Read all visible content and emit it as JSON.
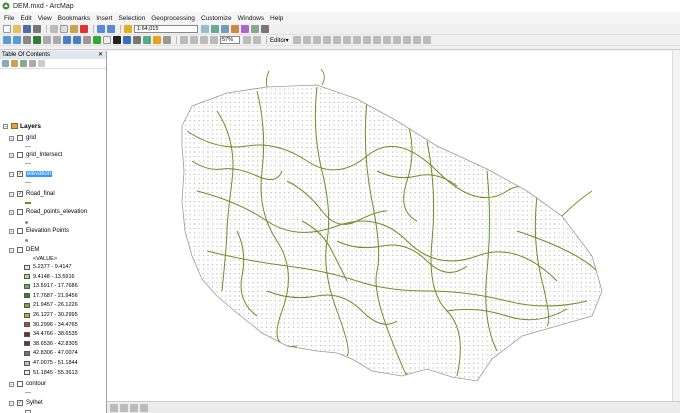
{
  "window": {
    "title": "DEM.mxd - ArcMap"
  },
  "menu": [
    "File",
    "Edit",
    "View",
    "Bookmarks",
    "Insert",
    "Selection",
    "Geoprocessing",
    "Customize",
    "Windows",
    "Help"
  ],
  "toolbar": {
    "scale": "1:64,015",
    "zoom": "57%",
    "editor_label": "Editor▾"
  },
  "toc": {
    "title": "Table Of Contents",
    "close_glyph": "✕",
    "root_label": "Layers",
    "layers": [
      {
        "name": "grid",
        "checked": false
      },
      {
        "name": "grid_Intersect",
        "checked": false
      },
      {
        "name": "elevation",
        "checked": true,
        "selected": true
      },
      {
        "name": "Road_final",
        "checked": true
      },
      {
        "name": "Road_points_elevation",
        "checked": false
      },
      {
        "name": "Elevation Points",
        "checked": false
      },
      {
        "name": "DEM",
        "checked": false
      },
      {
        "name": "contour",
        "checked": false
      },
      {
        "name": "Sylhet",
        "checked": true
      }
    ],
    "dem_field": "<VALUE>",
    "dem_classes": [
      {
        "label": "5.2377 - 9.4147",
        "color": "#d9f2d0"
      },
      {
        "label": "9.4148 - 13.5916",
        "color": "#a8dc8f"
      },
      {
        "label": "13.5917 - 17.7686",
        "color": "#5fb84a"
      },
      {
        "label": "17.7687 - 21.9456",
        "color": "#2d8a2a"
      },
      {
        "label": "21.9457 - 26.1226",
        "color": "#8aa13a"
      },
      {
        "label": "26.1227 - 30.2995",
        "color": "#c9a24a"
      },
      {
        "label": "30.2996 - 34.4765",
        "color": "#a0522d"
      },
      {
        "label": "34.4766 - 38.6535",
        "color": "#7a2a16"
      },
      {
        "label": "38.6536 - 42.8305",
        "color": "#6e3b2b"
      },
      {
        "label": "42.8306 - 47.0074",
        "color": "#8a6a5a"
      },
      {
        "label": "47.0075 - 51.1844",
        "color": "#c8bdb6"
      },
      {
        "label": "51.1845 - 55.3613",
        "color": "#f4f1ef"
      }
    ]
  },
  "colors": {
    "road": "#6b8e23",
    "grid_dot": "#9a9a9a",
    "boundary": "#9a9a9a",
    "selection": "#3399ff"
  }
}
